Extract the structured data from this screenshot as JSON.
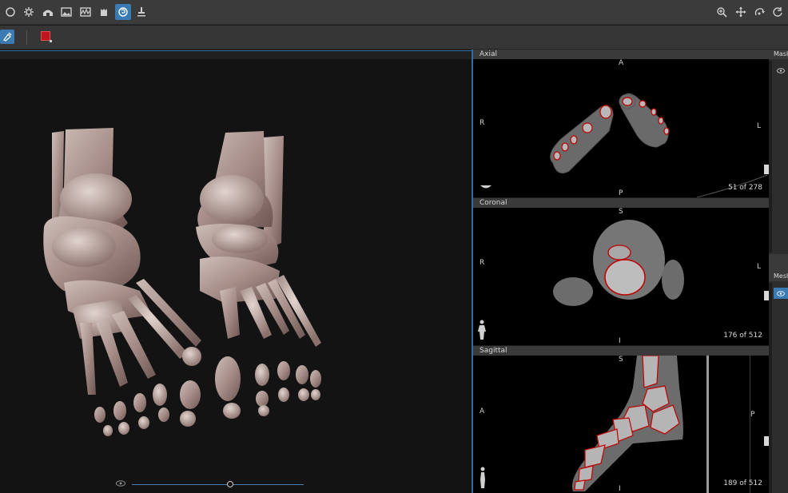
{
  "toolbar_top": {
    "left_icons": [
      "circle-icon",
      "gear-icon",
      "tunnel-icon",
      "image-icon",
      "waveform-icon",
      "jar-icon",
      "brain-icon",
      "stamp-icon"
    ],
    "active_index": 6,
    "right_icons": [
      "zoom-icon",
      "pan-icon",
      "rotate-icon",
      "reset-icon"
    ]
  },
  "toolbar_second": {
    "tools": [
      "brush-tool-icon",
      "color-swatch"
    ],
    "accent_color": "#c0141c",
    "active_color": "#3a7bb3"
  },
  "view3d": {
    "opacity_slider": 0.57
  },
  "axial": {
    "title": "Axial",
    "top": "A",
    "bottom": "P",
    "left": "R",
    "right": "L",
    "slice": "51 of 278"
  },
  "coronal": {
    "title": "Coronal",
    "top": "S",
    "bottom": "I",
    "left": "R",
    "right": "L",
    "slice": "176 of 512"
  },
  "sagittal": {
    "title": "Sagittal",
    "top": "S",
    "bottom": "I",
    "left": "A",
    "right": "P",
    "slice": "189 of 512"
  },
  "side_panel": {
    "mask_title": "Mask",
    "mesh_title": "Mesh"
  }
}
